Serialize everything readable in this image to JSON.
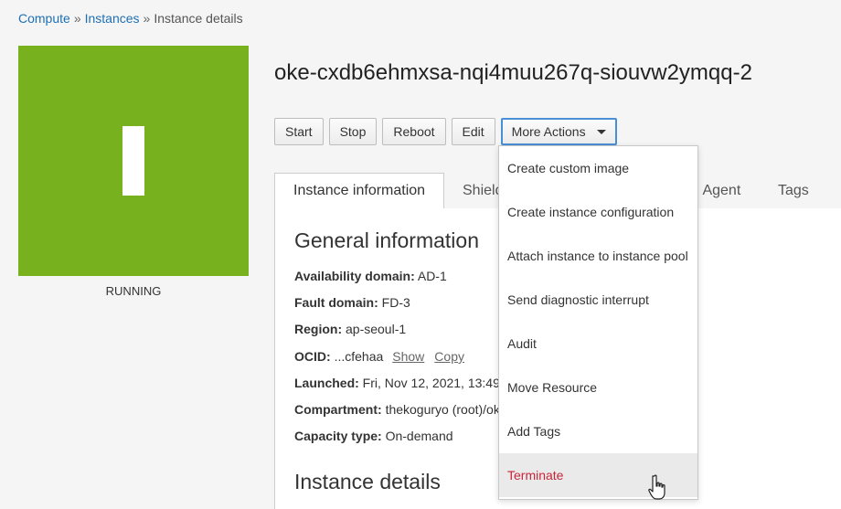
{
  "breadcrumb": {
    "compute": "Compute",
    "instances": "Instances",
    "current": "Instance details",
    "sep": "»"
  },
  "instance": {
    "name": "oke-cxdb6ehmxsa-nqi4muu267q-siouvw2ymqq-2",
    "letter": "I",
    "state": "RUNNING",
    "state_color": "#77b21e"
  },
  "actions": {
    "start": "Start",
    "stop": "Stop",
    "reboot": "Reboot",
    "edit": "Edit",
    "more": "More Actions"
  },
  "tabs": {
    "info": "Instance information",
    "shielded": "Shield",
    "agent": "d Agent",
    "tags": "Tags"
  },
  "general": {
    "title": "General information",
    "availability_domain": {
      "label": "Availability domain:",
      "value": "AD-1"
    },
    "fault_domain": {
      "label": "Fault domain:",
      "value": "FD-3"
    },
    "region": {
      "label": "Region:",
      "value": "ap-seoul-1"
    },
    "ocid": {
      "label": "OCID:",
      "value": "...cfehaa",
      "show": "Show",
      "copy": "Copy"
    },
    "launched": {
      "label": "Launched:",
      "value": "Fri, Nov 12, 2021, 13:49"
    },
    "compartment": {
      "label": "Compartment:",
      "value": "thekoguryo (root)/ok"
    },
    "capacity": {
      "label": "Capacity type:",
      "value": "On-demand"
    }
  },
  "details": {
    "title": "Instance details"
  },
  "menu": {
    "items": [
      "Create custom image",
      "Create instance configuration",
      "Attach instance to instance pool",
      "Send diagnostic interrupt",
      "Audit",
      "Move Resource",
      "Add Tags",
      "Terminate"
    ]
  },
  "icons": {
    "caret": "caret-down-icon",
    "cursor": "hand-pointer-icon"
  }
}
